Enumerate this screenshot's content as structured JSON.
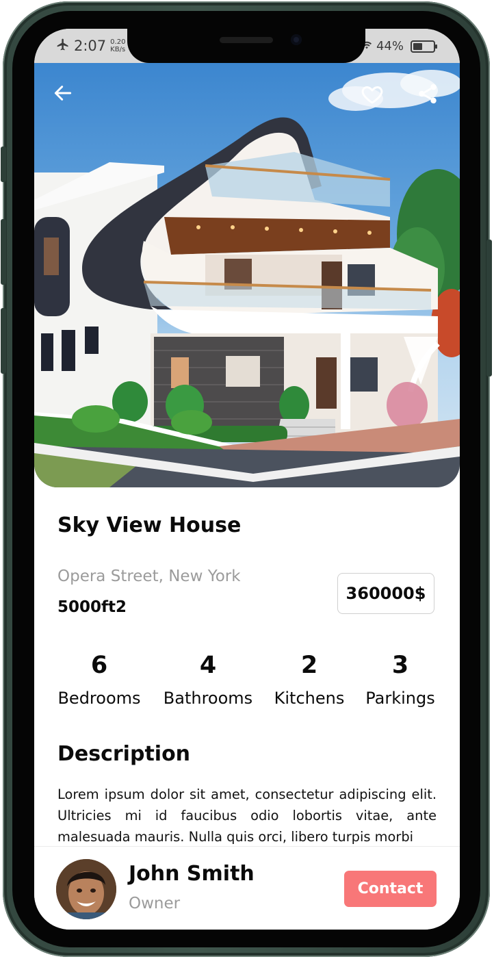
{
  "status_bar": {
    "time": "2:07",
    "speed_value": "0.20",
    "speed_unit": "KB/s",
    "battery": "44%",
    "airplane_icon": "airplane-icon",
    "wifi_icon": "wifi-icon",
    "battery_icon": "battery-icon"
  },
  "hero": {
    "back_icon": "arrow-left-icon",
    "favorite_icon": "heart-icon",
    "share_icon": "share-icon"
  },
  "property": {
    "title": "Sky View House",
    "address": "Opera Street, New York",
    "area": "5000ft2",
    "price": "360000$"
  },
  "stats": [
    {
      "value": "6",
      "label": "Bedrooms"
    },
    {
      "value": "4",
      "label": "Bathrooms"
    },
    {
      "value": "2",
      "label": "Kitchens"
    },
    {
      "value": "3",
      "label": "Parkings"
    }
  ],
  "description": {
    "heading": "Description",
    "text": "Lorem ipsum dolor sit amet, consectetur adipiscing elit. Ultricies mi id faucibus odio lobortis vitae, ante malesuada mauris. Nulla quis orci, libero turpis morbi"
  },
  "owner": {
    "name": "John Smith",
    "role": "Owner",
    "contact_label": "Contact"
  },
  "colors": {
    "accent": "#f87778",
    "frame": "#33473f",
    "muted_text": "#9b9b9b"
  }
}
